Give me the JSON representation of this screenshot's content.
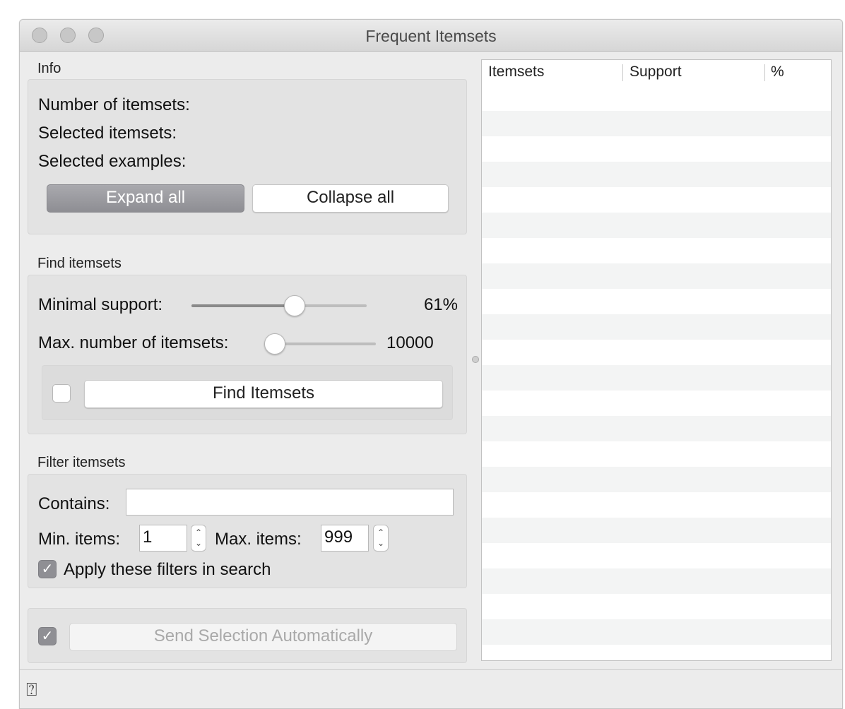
{
  "window": {
    "title": "Frequent Itemsets"
  },
  "info": {
    "section_label": "Info",
    "num_itemsets_label": "Number of itemsets:",
    "selected_itemsets_label": "Selected itemsets:",
    "selected_examples_label": "Selected examples:",
    "expand_all": "Expand all",
    "collapse_all": "Collapse all"
  },
  "find": {
    "section_label": "Find itemsets",
    "min_support_label": "Minimal support:",
    "min_support_value": "61%",
    "min_support_fraction": 0.6,
    "max_itemsets_label": "Max. number of itemsets:",
    "max_itemsets_value": "10000",
    "max_itemsets_fraction": 0.0,
    "find_button": "Find Itemsets",
    "auto_find_checked": false
  },
  "filter": {
    "section_label": "Filter itemsets",
    "contains_label": "Contains:",
    "contains_value": "",
    "min_items_label": "Min. items:",
    "min_items_value": "1",
    "max_items_label": "Max. items:",
    "max_items_value": "999",
    "apply_label": "Apply these filters in search",
    "apply_checked": true
  },
  "send": {
    "send_button": "Send Selection Automatically",
    "auto_send_checked": true
  },
  "table": {
    "columns": [
      "Itemsets",
      "Support",
      "%"
    ],
    "rows": []
  },
  "icons": {
    "check": "checkmark-icon",
    "help": "help-icon"
  }
}
